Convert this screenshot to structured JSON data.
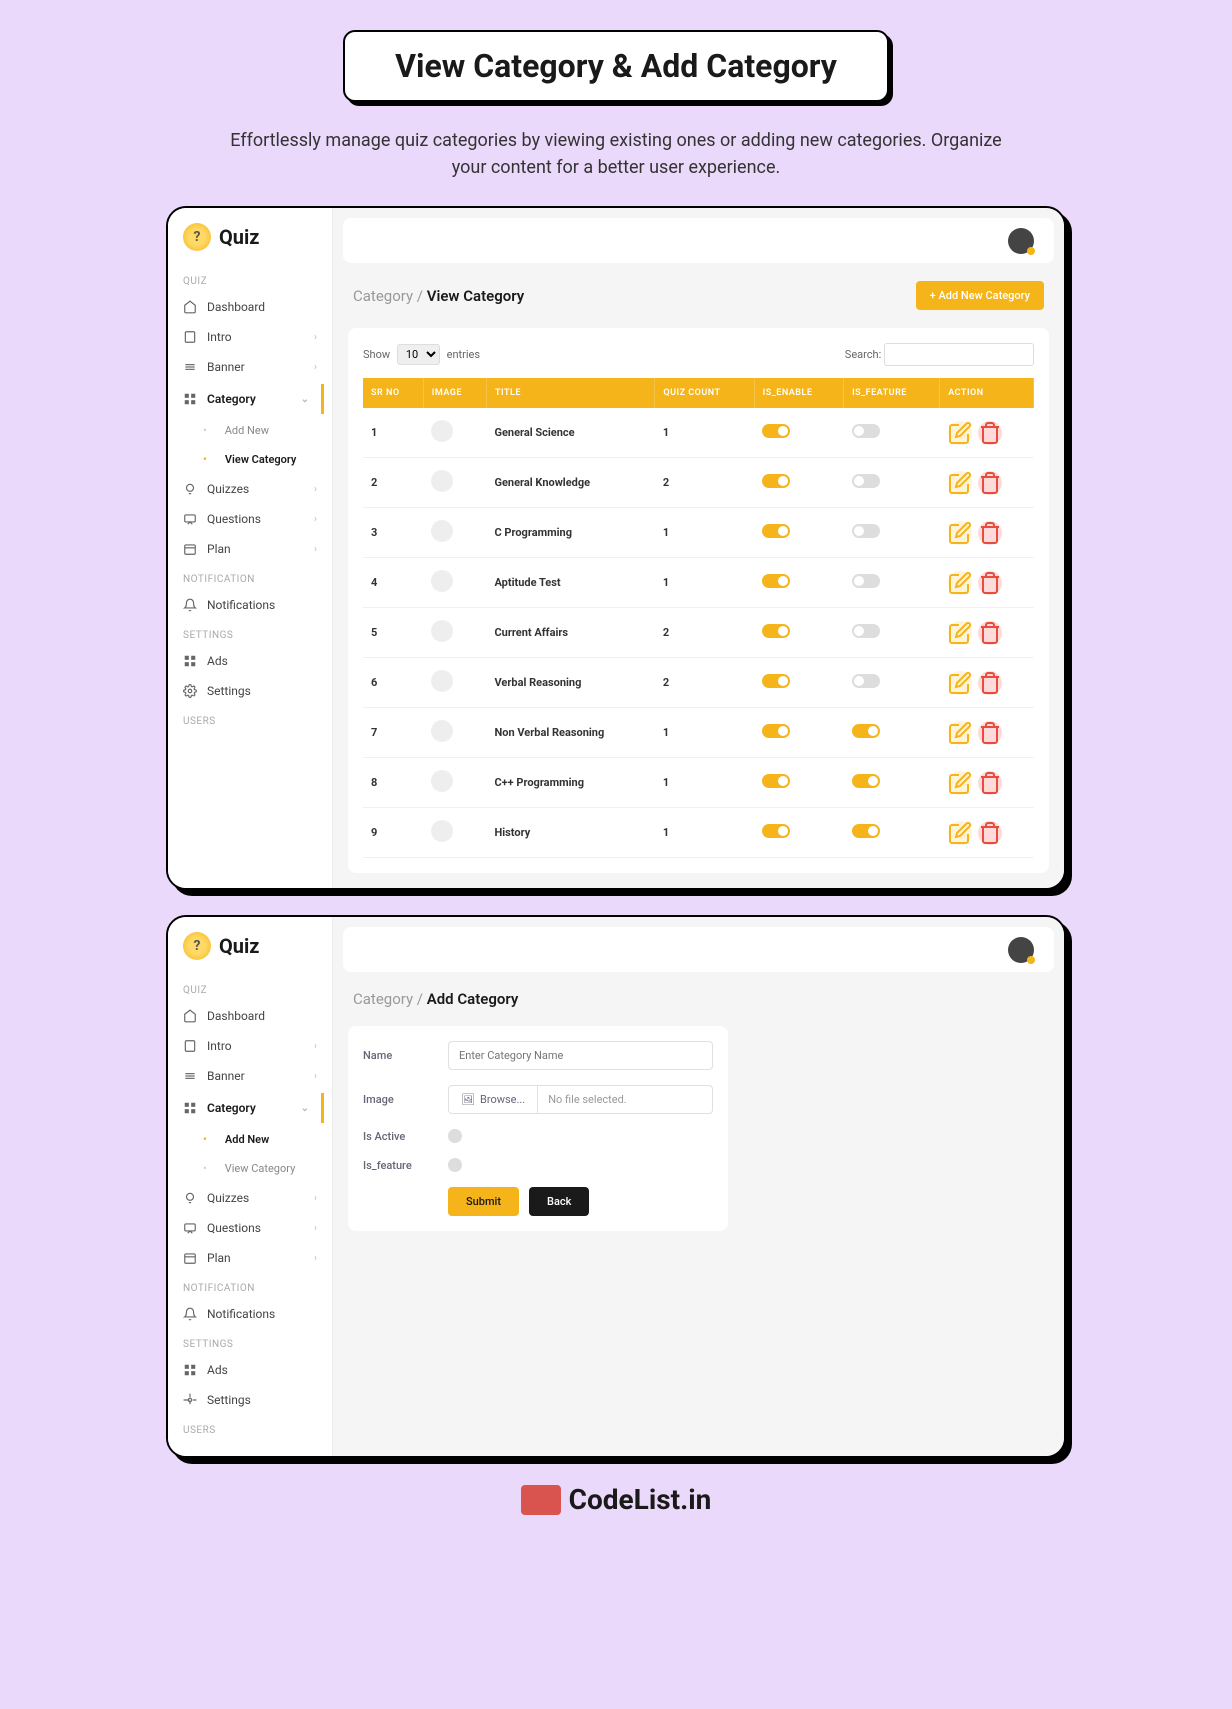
{
  "header": {
    "title": "View Category & Add Category",
    "subtitle": "Effortlessly manage quiz categories by viewing existing ones or adding new categories. Organize your content for a better user experience."
  },
  "app": {
    "logo": "Quiz",
    "sidebar": {
      "sec_quiz": "QUIZ",
      "sec_notification": "NOTIFICATION",
      "sec_settings": "SETTINGS",
      "sec_users": "USERS",
      "dashboard": "Dashboard",
      "intro": "Intro",
      "banner": "Banner",
      "category": "Category",
      "add_new": "Add New",
      "view_category": "View Category",
      "quizzes": "Quizzes",
      "questions": "Questions",
      "plan": "Plan",
      "notifications": "Notifications",
      "ads": "Ads",
      "settings": "Settings"
    }
  },
  "view": {
    "bc_parent": "Category",
    "bc_current": "View Category",
    "add_button": "+ Add New Category",
    "show_label": "Show",
    "show_value": "10",
    "entries_label": "entries",
    "search_label": "Search:",
    "columns": {
      "sr": "SR NO",
      "image": "IMAGE",
      "title": "TITLE",
      "quiz_count": "QUIZ COUNT",
      "is_enable": "IS_ENABLE",
      "is_feature": "IS_FEATURE",
      "action": "ACTION"
    },
    "rows": [
      {
        "sr": "1",
        "title": "General Science",
        "count": "1",
        "enable": true,
        "feature": false
      },
      {
        "sr": "2",
        "title": "General Knowledge",
        "count": "2",
        "enable": true,
        "feature": false
      },
      {
        "sr": "3",
        "title": "C Programming",
        "count": "1",
        "enable": true,
        "feature": false
      },
      {
        "sr": "4",
        "title": "Aptitude Test",
        "count": "1",
        "enable": true,
        "feature": false
      },
      {
        "sr": "5",
        "title": "Current Affairs",
        "count": "2",
        "enable": true,
        "feature": false
      },
      {
        "sr": "6",
        "title": "Verbal Reasoning",
        "count": "2",
        "enable": true,
        "feature": false
      },
      {
        "sr": "7",
        "title": "Non Verbal Reasoning",
        "count": "1",
        "enable": true,
        "feature": true
      },
      {
        "sr": "8",
        "title": "C++ Programming",
        "count": "1",
        "enable": true,
        "feature": true
      },
      {
        "sr": "9",
        "title": "History",
        "count": "1",
        "enable": true,
        "feature": true
      }
    ]
  },
  "add": {
    "bc_parent": "Category",
    "bc_current": "Add Category",
    "name_label": "Name",
    "name_placeholder": "Enter Category Name",
    "image_label": "Image",
    "browse_label": "Browse...",
    "no_file": "No file selected.",
    "is_active": "Is Active",
    "is_feature": "Is_feature",
    "submit": "Submit",
    "back": "Back"
  },
  "footer": {
    "brand": "CodeList.in"
  }
}
